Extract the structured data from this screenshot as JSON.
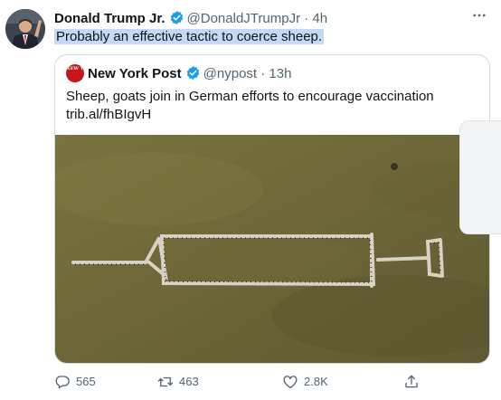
{
  "tweet": {
    "author_name": "Donald Trump Jr.",
    "handle": "@DonaldJTrumpJr",
    "separator": "·",
    "time": "4h",
    "text": "Probably an effective tactic to coerce sheep.",
    "more_icon": "more-dots-icon"
  },
  "quoted_tweet": {
    "author_name": "New York Post",
    "avatar_text": "NEW YORK POST",
    "handle": "@nypost",
    "separator": "·",
    "time": "13h",
    "text_line1": "Sheep, goats join in German efforts to encourage vaccination",
    "link": "trib.al/fhBIgvH",
    "image_description_icon": "syringe-formation-photo"
  },
  "actions": {
    "replies": "565",
    "retweets": "463",
    "likes": "2.8K"
  },
  "colors": {
    "verified_blue": "#1d9bf0",
    "secondary_text": "#536471",
    "selection_highlight": "#c5d9f7",
    "nypost_red": "#c4161c",
    "field_green": "#6f6a3c"
  }
}
